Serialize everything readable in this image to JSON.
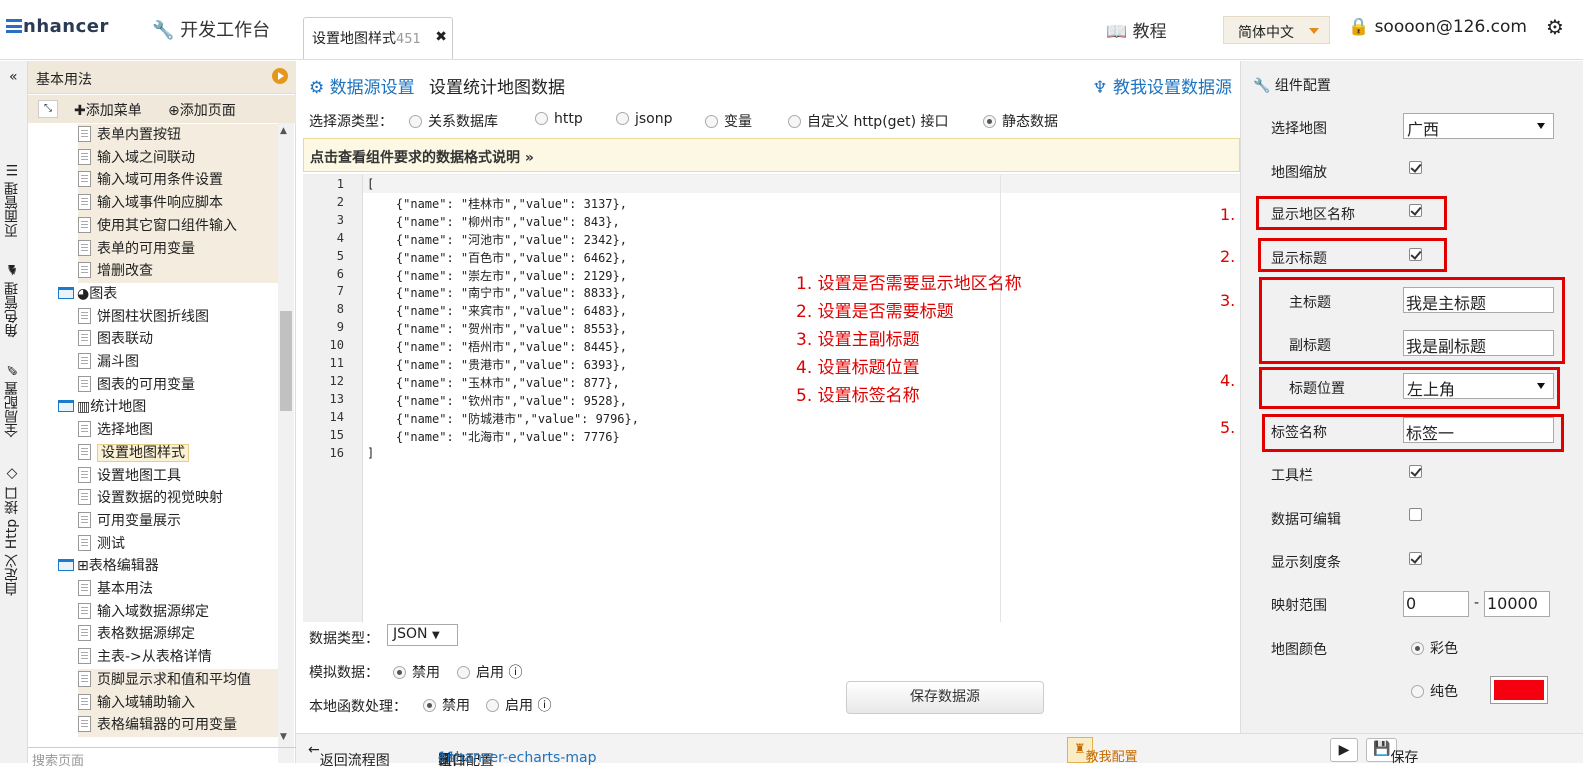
{
  "app": {
    "logo": "nhancer",
    "dev_bench": "开发工作台",
    "tab_title": "设置地图样式",
    "tab_num": "451",
    "tutorial": "教程",
    "language": "简体中文",
    "user": "soooon@126.com"
  },
  "vtabs": [
    "页面管理",
    "角色管理",
    "全局配置",
    "自定义 Http 接口"
  ],
  "tree": {
    "header": "基本用法",
    "add_menu": "添加菜单",
    "add_page": "添加页面",
    "items": [
      {
        "label": "表单内置按钮",
        "type": "doc",
        "level": 2,
        "hl": true
      },
      {
        "label": "输入域之间联动",
        "type": "doc",
        "level": 2,
        "hl": true
      },
      {
        "label": "输入域可用条件设置",
        "type": "doc",
        "level": 2,
        "hl": true
      },
      {
        "label": "输入域事件响应脚本",
        "type": "doc",
        "level": 2,
        "hl": true
      },
      {
        "label": "使用其它窗口组件输入",
        "type": "doc",
        "level": 2,
        "hl": true
      },
      {
        "label": "表单的可用变量",
        "type": "doc",
        "level": 2,
        "hl": true
      },
      {
        "label": "增删改查",
        "type": "doc",
        "level": 2,
        "hl": true
      },
      {
        "label": "图表",
        "type": "folder-pie",
        "level": 1,
        "hl": false
      },
      {
        "label": "饼图柱状图折线图",
        "type": "doc",
        "level": 2,
        "hl": false
      },
      {
        "label": "图表联动",
        "type": "doc",
        "level": 2,
        "hl": false
      },
      {
        "label": "漏斗图",
        "type": "doc",
        "level": 2,
        "hl": false
      },
      {
        "label": "图表的可用变量",
        "type": "doc",
        "level": 2,
        "hl": false
      },
      {
        "label": "统计地图",
        "type": "folder-bar",
        "level": 1,
        "hl": false
      },
      {
        "label": "选择地图",
        "type": "doc",
        "level": 2,
        "hl": false
      },
      {
        "label": "设置地图样式",
        "type": "doc",
        "level": 2,
        "hl": false,
        "selected": true
      },
      {
        "label": "设置地图工具",
        "type": "doc",
        "level": 2,
        "hl": false
      },
      {
        "label": "设置数据的视觉映射",
        "type": "doc",
        "level": 2,
        "hl": false
      },
      {
        "label": "可用变量展示",
        "type": "doc",
        "level": 2,
        "hl": false
      },
      {
        "label": "测试",
        "type": "doc",
        "level": 2,
        "hl": false
      },
      {
        "label": "表格编辑器",
        "type": "folder-table",
        "level": 1,
        "hl": false
      },
      {
        "label": "基本用法",
        "type": "doc",
        "level": 2,
        "hl": false
      },
      {
        "label": "输入域数据源绑定",
        "type": "doc",
        "level": 2,
        "hl": false
      },
      {
        "label": "表格数据源绑定",
        "type": "doc",
        "level": 2,
        "hl": false
      },
      {
        "label": "主表->从表格详情",
        "type": "doc",
        "level": 2,
        "hl": false
      },
      {
        "label": "页脚显示求和值和平均值",
        "type": "doc",
        "level": 2,
        "hl": true
      },
      {
        "label": "输入域辅助输入",
        "type": "doc",
        "level": 2,
        "hl": true
      },
      {
        "label": "表格编辑器的可用变量",
        "type": "doc",
        "level": 2,
        "hl": true
      }
    ],
    "search_placeholder": "搜索页面"
  },
  "datasource": {
    "title": "数据源设置",
    "subtitle": "设置统计地图数据",
    "help": "教我设置数据源",
    "source_type_label": "选择源类型：",
    "source_types": [
      "关系数据库",
      "http",
      "jsonp",
      "变量",
      "自定义 http(get) 接口",
      "静态数据"
    ],
    "notice": "点击查看组件要求的数据格式说明 »",
    "code_lines": [
      "[",
      "    {\"name\": \"桂林市\",\"value\": 3137},",
      "    {\"name\": \"柳州市\",\"value\": 843},",
      "    {\"name\": \"河池市\",\"value\": 2342},",
      "    {\"name\": \"百色市\",\"value\": 6462},",
      "    {\"name\": \"崇左市\",\"value\": 2129},",
      "    {\"name\": \"南宁市\",\"value\": 8833},",
      "    {\"name\": \"来宾市\",\"value\": 6483},",
      "    {\"name\": \"贺州市\",\"value\": 8553},",
      "    {\"name\": \"梧州市\",\"value\": 8445},",
      "    {\"name\": \"贵港市\",\"value\": 6393},",
      "    {\"name\": \"玉林市\",\"value\": 877},",
      "    {\"name\": \"钦州市\",\"value\": 9528},",
      "    {\"name\": \"防城港市\",\"value\": 9796},",
      "    {\"name\": \"北海市\",\"value\": 7776}",
      "]"
    ],
    "annotations": [
      "1. 设置是否需要显示地区名称",
      "2. 设置是否需要标题",
      "3. 设置主副标题",
      "4. 设置标题位置",
      "5. 设置标签名称"
    ],
    "data_type_label": "数据类型：",
    "data_type": "JSON",
    "mock_label": "模拟数据：",
    "local_fn_label": "本地函数处理：",
    "disable": "禁用",
    "enable": "启用",
    "save": "保存数据源"
  },
  "config": {
    "title": "组件配置",
    "select_map_label": "选择地图",
    "select_map": "广西",
    "zoom_label": "地图缩放",
    "show_region_label": "显示地区名称",
    "show_title_label": "显示标题",
    "main_title_label": "主标题",
    "main_title": "我是主标题",
    "sub_title_label": "副标题",
    "sub_title": "我是副标题",
    "title_pos_label": "标题位置",
    "title_pos": "左上角",
    "tag_label": "标签名称",
    "tag": "标签一",
    "toolbar_label": "工具栏",
    "editable_label": "数据可编辑",
    "scale_label": "显示刻度条",
    "range_label": "映射范围",
    "range_min": "0",
    "range_max": "10000",
    "color_label": "地图颜色",
    "color_opt1": "彩色",
    "color_opt2": "纯色",
    "solid_color": "#f5000f",
    "box_nums": [
      "1.",
      "2.",
      "3.",
      "4.",
      "5."
    ]
  },
  "status": {
    "back": "返回流程图",
    "window": "窗口",
    "window_num": "11",
    "arrow": "→",
    "component": "组件配置",
    "component_name": "enhancer-echarts-map",
    "teach": "教我配置",
    "save": "保存"
  }
}
